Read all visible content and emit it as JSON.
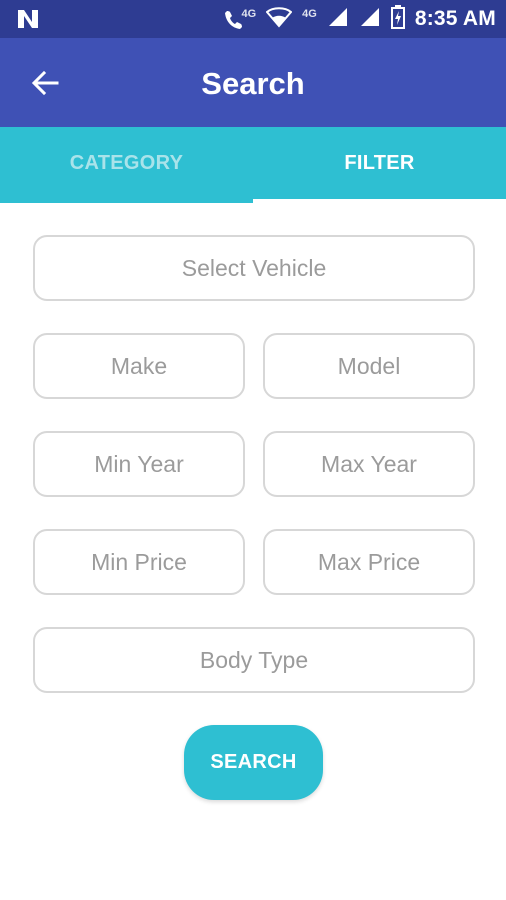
{
  "status_bar": {
    "network_4g_a": "4G",
    "network_4g_b": "4G",
    "time": "8:35 AM"
  },
  "app_bar": {
    "title": "Search"
  },
  "tabs": [
    {
      "label": "CATEGORY",
      "active": false
    },
    {
      "label": "FILTER",
      "active": true
    }
  ],
  "form": {
    "select_vehicle": "Select Vehicle",
    "make": "Make",
    "model": "Model",
    "min_year": "Min Year",
    "max_year": "Max Year",
    "min_price": "Min Price",
    "max_price": "Max Price",
    "body_type": "Body Type",
    "search_button": "SEARCH"
  },
  "colors": {
    "status_bar": "#2e3c92",
    "app_bar": "#3f51b5",
    "accent": "#2ebfd2"
  }
}
